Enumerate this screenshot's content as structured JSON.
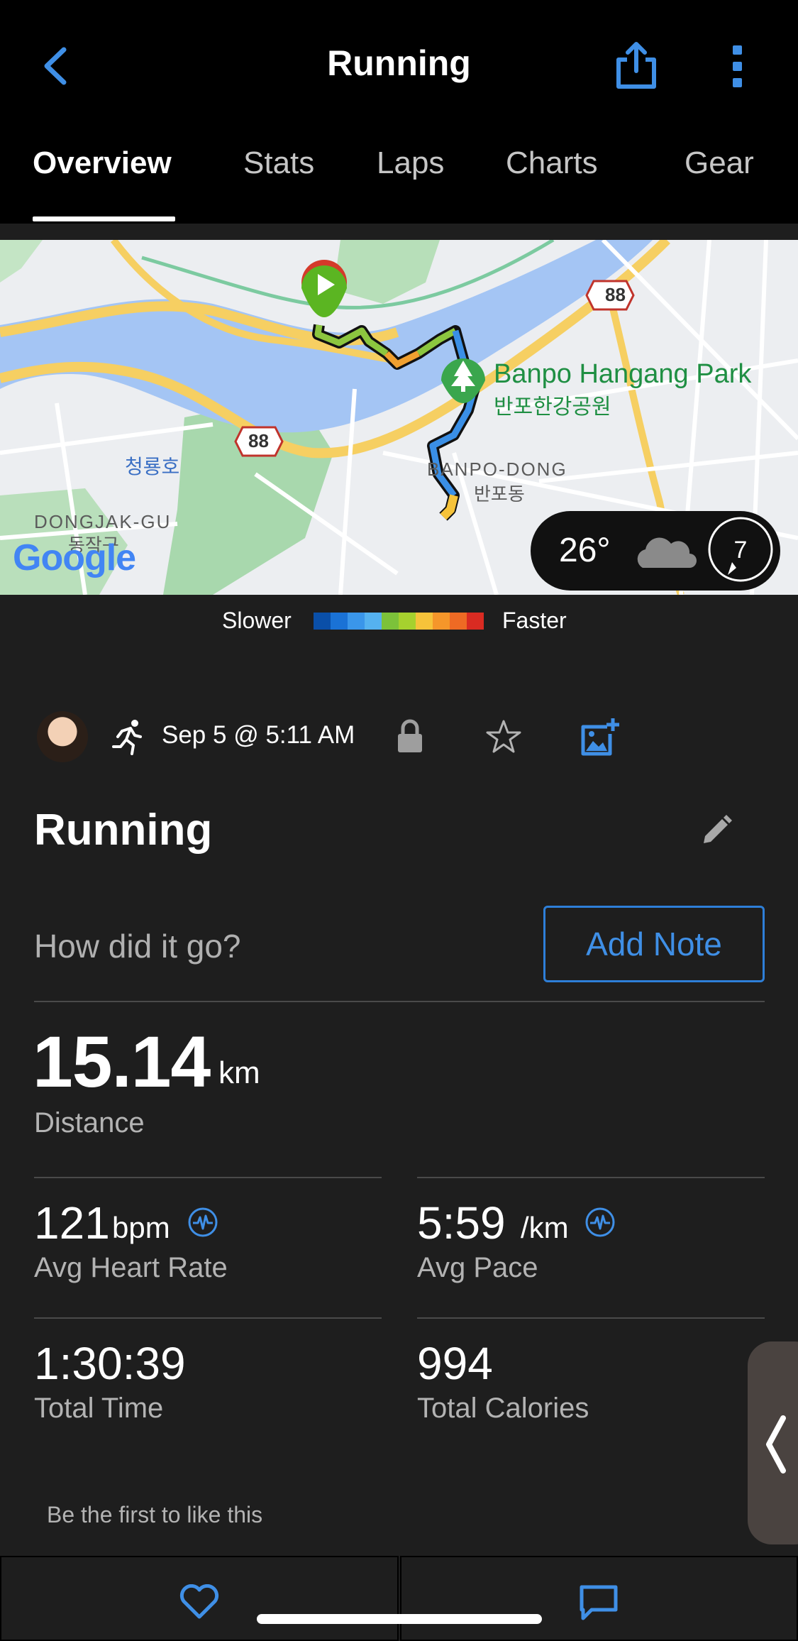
{
  "header": {
    "title": "Running",
    "tabs": [
      {
        "label": "Overview",
        "active": true
      },
      {
        "label": "Stats"
      },
      {
        "label": "Laps"
      },
      {
        "label": "Charts"
      },
      {
        "label": "Gear"
      }
    ]
  },
  "map": {
    "labels": {
      "park_en": "Banpo Hangang Park",
      "park_ko": "반포한강공원",
      "district_en": "BANPO-DONG",
      "district_ko": "반포동",
      "dongjak_en": "DONGJAK-GU",
      "dongjak_ko": "동작구",
      "lake_ko": "청룡호",
      "route_88a": "88",
      "route_88b": "88",
      "logo": "Google"
    },
    "weather": {
      "temperature": "26°",
      "wind": "7",
      "icon": "cloud-icon"
    }
  },
  "legend": {
    "slower": "Slower",
    "faster": "Faster",
    "colors": [
      "#0a4fa8",
      "#1a72d6",
      "#3a96ea",
      "#55b2f0",
      "#7cc23a",
      "#a6d12e",
      "#f6c33a",
      "#f5962a",
      "#ee6a24",
      "#d92b22"
    ]
  },
  "activity": {
    "date": "Sep 5 @ 5:11 AM",
    "name": "Running",
    "note_prompt": "How did it go?",
    "add_note": "Add Note"
  },
  "stats": {
    "distance": {
      "value": "15.14",
      "unit": "km",
      "label": "Distance"
    },
    "heart_rate": {
      "value": "121",
      "unit": "bpm",
      "label": "Avg Heart Rate"
    },
    "pace": {
      "value": "5:59",
      "unit": "/km",
      "label": "Avg Pace"
    },
    "time": {
      "value": "1:30:39",
      "label": "Total Time"
    },
    "calories": {
      "value": "994",
      "label": "Total Calories"
    }
  },
  "social": {
    "like_prompt": "Be the first to like this"
  },
  "colors": {
    "accent": "#3f8fe6",
    "background": "#1e1e1e",
    "header": "#000000"
  }
}
